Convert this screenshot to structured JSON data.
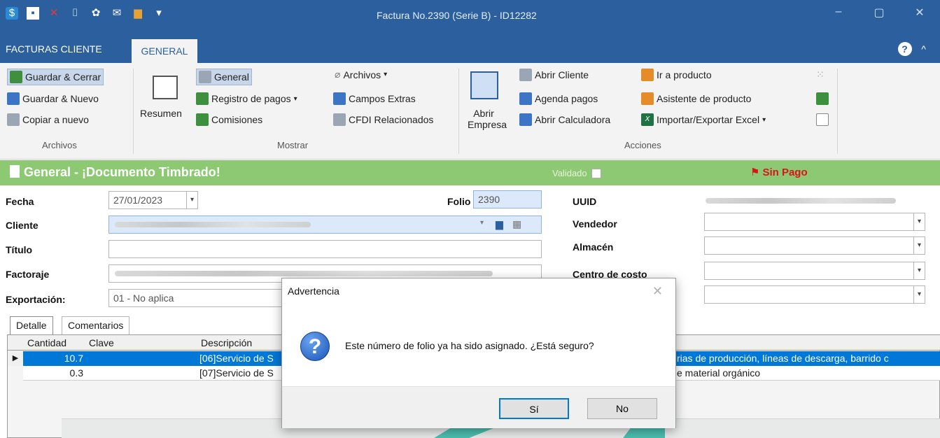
{
  "window": {
    "title": "Factura No.2390 (Serie B) - ID12282",
    "controls": [
      "–",
      "▢",
      "✕"
    ]
  },
  "ribbon_tabs": {
    "file": "FACTURAS CLIENTE",
    "active": "GENERAL",
    "help": "?",
    "collapse": "^"
  },
  "ribbon": {
    "archivos_group": {
      "items": [
        "Guardar & Cerrar",
        "Guardar & Nuevo",
        "Copiar a nuevo"
      ],
      "label": "Archivos"
    },
    "mostrar_group": {
      "resumen": "Resumen",
      "items_col1": [
        "General",
        "Registro de pagos",
        "Comisiones"
      ],
      "items_col2": [
        "Archivos",
        "Campos Extras",
        "CFDI Relacionados"
      ],
      "label": "Mostrar"
    },
    "acciones_group": {
      "abrir_empresa": "Abrir Empresa",
      "items_col1": [
        "Abrir Cliente",
        "Agenda pagos",
        "Abrir Calculadora"
      ],
      "items_col2": [
        "Ir a producto",
        "Asistente de producto",
        "Importar/Exportar Excel"
      ],
      "label": "Acciones"
    }
  },
  "banner": {
    "title": "General - ¡Documento Timbrado!",
    "validado": "Validado",
    "status": "Sin Pago",
    "status_color": "#d8141c",
    "banner_color": "#8dc873"
  },
  "form": {
    "fecha_label": "Fecha",
    "fecha_value": "27/01/2023",
    "folio_label": "Folio",
    "folio_value": "2390",
    "cliente_label": "Cliente",
    "titulo_label": "Título",
    "factoraje_label": "Factoraje",
    "exportacion_label": "Exportación:",
    "exportacion_value": "01 - No aplica",
    "uuid_label": "UUID",
    "vendedor_label": "Vendedor",
    "almacen_label": "Almacén",
    "centro_label": "Centro de costo"
  },
  "detail_tabs": [
    "Detalle",
    "Comentarios"
  ],
  "grid": {
    "columns": [
      "Cantidad",
      "Clave",
      "Descripción"
    ],
    "rows": [
      {
        "cantidad": "10.7",
        "clave": "",
        "descripcion": "[06]Servicio de S",
        "tail": "rias de producción, líneas de descarga, barrido c"
      },
      {
        "cantidad": "0.3",
        "clave": "",
        "descripcion": "[07]Servicio de S",
        "tail": "e material orgánico"
      }
    ]
  },
  "dialog": {
    "title": "Advertencia",
    "close": "✕",
    "icon": "?",
    "message": "Este número de folio ya ha sido asignado. ¿Está seguro?",
    "yes": "Sí",
    "no": "No"
  },
  "colors": {
    "accent": "#2c5f9e",
    "selection": "#0078d7",
    "callout": "#4dbfb0"
  }
}
